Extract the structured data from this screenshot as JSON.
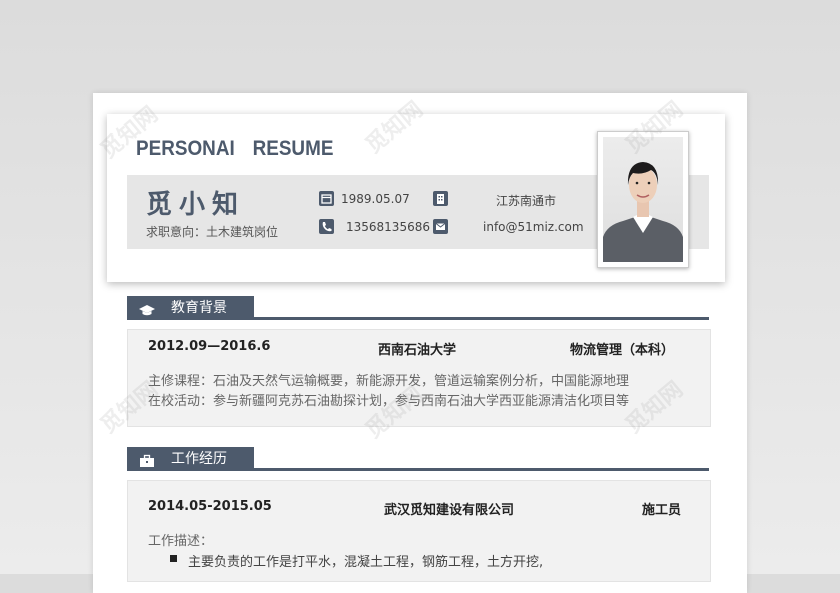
{
  "header": {
    "title": "PERSONAI  RESUME",
    "name": "觅小知",
    "intent": "求职意向：土木建筑岗位",
    "birth": "1989.05.07",
    "location": "江苏南通市",
    "phone": "13568135686",
    "email": "info@51miz.com"
  },
  "education": {
    "title": "教育背景",
    "period": "2012.09—2016.6",
    "school": "西南石油大学",
    "major": "物流管理（本科）",
    "lines": [
      "主修课程：石油及天然气运输概要，新能源开发，管道运输案例分析，中国能源地理",
      "在校活动：参与新疆阿克苏石油勘探计划，参与西南石油大学西亚能源清洁化项目等"
    ]
  },
  "work": {
    "title": "工作经历",
    "period": "2014.05-2015.05",
    "company": "武汉觅知建设有限公司",
    "position": "施工员",
    "desc_label": "工作描述：",
    "bullets": [
      "主要负责的工作是打平水，混凝土工程，钢筋工程，土方开挖,"
    ]
  },
  "watermark": "觅知网",
  "colors": {
    "accent": "#4d5a6c",
    "band": "#e6e6e6"
  },
  "icons": [
    "calendar-icon",
    "phone-icon",
    "building-icon",
    "mail-icon",
    "graduation-cap-icon",
    "briefcase-icon"
  ]
}
